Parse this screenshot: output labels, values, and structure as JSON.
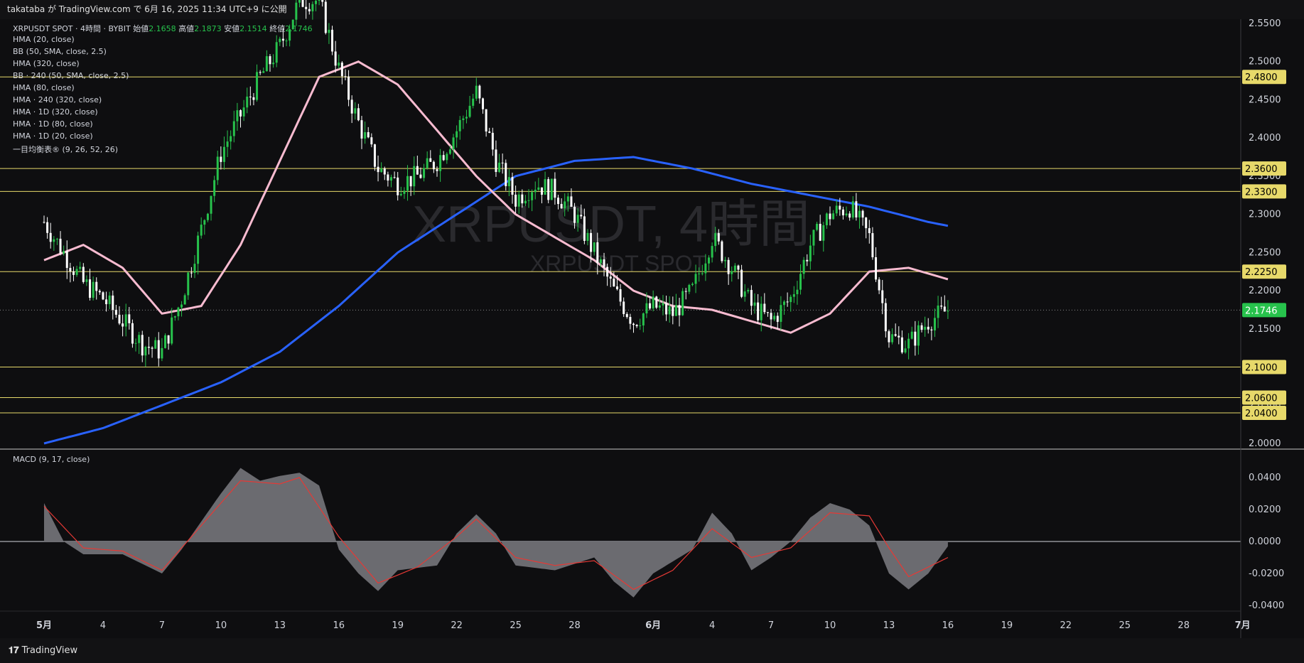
{
  "header": {
    "publish_text": "takataba が TradingView.com で 6月 16, 2025 11:34 UTC+9 に公開"
  },
  "footer": {
    "brand": "TradingView"
  },
  "symbol_info": {
    "name": "XRPUSDT SPOT · 4時間 · BYBIT",
    "open_label": "始値",
    "open": "2.1658",
    "high_label": "高値",
    "high": "2.1873",
    "low_label": "安値",
    "low": "2.1514",
    "close_label": "終値",
    "close": "2.1746"
  },
  "indicators": [
    "HMA (20, close)",
    "BB (50, SMA, close, 2.5)",
    "HMA (320, close)",
    "BB · 240 (50, SMA, close, 2.5)",
    "HMA (80, close)",
    "HMA · 240 (320, close)",
    "HMA · 1D (320, close)",
    "HMA · 1D (80, close)",
    "HMA · 1D (20, close)",
    "一目均衡表® (9, 26, 52, 26)"
  ],
  "watermark": {
    "main": "XRPUSDT, 4時間",
    "sub": "XRPUSDT SPOT"
  },
  "macd_label": "MACD (9, 17, close)",
  "colors": {
    "background": "#0e0e10",
    "up": "#27c24c",
    "down": "#ffffff",
    "level": "#e7d96a",
    "current_price": "#27c24c",
    "hma320": "#2962ff",
    "hma80": "#f8bbd0"
  },
  "chart_data": [
    {
      "type": "candlestick",
      "title": "XRPUSDT SPOT · 4時間 · BYBIT",
      "ylim": [
        2.0,
        2.55
      ],
      "y_ticks": [
        "2.5500",
        "2.5000",
        "2.4500",
        "2.4000",
        "2.3500",
        "2.3000",
        "2.2500",
        "2.2000",
        "2.1500",
        "2.1000",
        "2.0500",
        "2.0000"
      ],
      "x_ticks": [
        {
          "label": "5月",
          "day": 1
        },
        {
          "label": "4",
          "day": 4
        },
        {
          "label": "7",
          "day": 7
        },
        {
          "label": "10",
          "day": 10
        },
        {
          "label": "13",
          "day": 13
        },
        {
          "label": "16",
          "day": 16
        },
        {
          "label": "19",
          "day": 19
        },
        {
          "label": "22",
          "day": 22
        },
        {
          "label": "25",
          "day": 25
        },
        {
          "label": "28",
          "day": 28
        },
        {
          "label": "6月",
          "day": 32
        },
        {
          "label": "4",
          "day": 35
        },
        {
          "label": "7",
          "day": 38
        },
        {
          "label": "10",
          "day": 41
        },
        {
          "label": "13",
          "day": 44
        },
        {
          "label": "16",
          "day": 47
        },
        {
          "label": "19",
          "day": 50
        },
        {
          "label": "22",
          "day": 53
        },
        {
          "label": "25",
          "day": 56
        },
        {
          "label": "28",
          "day": 59
        },
        {
          "label": "7月",
          "day": 62
        }
      ],
      "price_levels": [
        {
          "label": "2.4800",
          "value": 2.48
        },
        {
          "label": "2.3600",
          "value": 2.36
        },
        {
          "label": "2.3300",
          "value": 2.33
        },
        {
          "label": "2.2250",
          "value": 2.225
        },
        {
          "label": "2.1000",
          "value": 2.1
        },
        {
          "label": "2.0600",
          "value": 2.06
        },
        {
          "label": "2.0400",
          "value": 2.04
        }
      ],
      "current_price": {
        "label": "2.1746",
        "value": 2.1746
      },
      "price_path": [
        [
          1,
          2.29
        ],
        [
          2,
          2.25
        ],
        [
          3,
          2.21
        ],
        [
          4,
          2.19
        ],
        [
          5,
          2.16
        ],
        [
          6,
          2.13
        ],
        [
          7,
          2.12
        ],
        [
          8,
          2.19
        ],
        [
          9,
          2.28
        ],
        [
          10,
          2.38
        ],
        [
          11,
          2.43
        ],
        [
          12,
          2.48
        ],
        [
          13,
          2.52
        ],
        [
          14,
          2.58
        ],
        [
          15,
          2.58
        ],
        [
          16,
          2.49
        ],
        [
          17,
          2.42
        ],
        [
          18,
          2.36
        ],
        [
          19,
          2.34
        ],
        [
          20,
          2.35
        ],
        [
          21,
          2.37
        ],
        [
          22,
          2.41
        ],
        [
          23,
          2.46
        ],
        [
          24,
          2.37
        ],
        [
          25,
          2.32
        ],
        [
          26,
          2.34
        ],
        [
          27,
          2.33
        ],
        [
          28,
          2.3
        ],
        [
          29,
          2.25
        ],
        [
          30,
          2.2
        ],
        [
          31,
          2.16
        ],
        [
          32,
          2.18
        ],
        [
          33,
          2.17
        ],
        [
          34,
          2.2
        ],
        [
          35,
          2.27
        ],
        [
          36,
          2.23
        ],
        [
          37,
          2.18
        ],
        [
          38,
          2.16
        ],
        [
          39,
          2.19
        ],
        [
          40,
          2.26
        ],
        [
          41,
          2.3
        ],
        [
          42,
          2.31
        ],
        [
          43,
          2.27
        ],
        [
          44,
          2.14
        ],
        [
          45,
          2.13
        ],
        [
          46,
          2.16
        ],
        [
          47,
          2.175
        ]
      ],
      "series": [
        {
          "name": "HMA (320, close)",
          "color": "#2962ff",
          "points": [
            [
              1,
              2.0
            ],
            [
              4,
              2.02
            ],
            [
              7,
              2.05
            ],
            [
              10,
              2.08
            ],
            [
              13,
              2.12
            ],
            [
              16,
              2.18
            ],
            [
              19,
              2.25
            ],
            [
              22,
              2.3
            ],
            [
              25,
              2.35
            ],
            [
              28,
              2.37
            ],
            [
              31,
              2.375
            ],
            [
              34,
              2.36
            ],
            [
              37,
              2.34
            ],
            [
              40,
              2.325
            ],
            [
              43,
              2.31
            ],
            [
              46,
              2.29
            ],
            [
              47,
              2.285
            ]
          ]
        },
        {
          "name": "HMA (80, close)",
          "color": "#f8bbd0",
          "points": [
            [
              1,
              2.24
            ],
            [
              3,
              2.26
            ],
            [
              5,
              2.23
            ],
            [
              7,
              2.17
            ],
            [
              9,
              2.18
            ],
            [
              11,
              2.26
            ],
            [
              13,
              2.37
            ],
            [
              15,
              2.48
            ],
            [
              17,
              2.5
            ],
            [
              19,
              2.47
            ],
            [
              21,
              2.41
            ],
            [
              23,
              2.35
            ],
            [
              25,
              2.3
            ],
            [
              27,
              2.27
            ],
            [
              29,
              2.24
            ],
            [
              31,
              2.2
            ],
            [
              33,
              2.18
            ],
            [
              35,
              2.175
            ],
            [
              37,
              2.16
            ],
            [
              39,
              2.145
            ],
            [
              41,
              2.17
            ],
            [
              43,
              2.225
            ],
            [
              45,
              2.23
            ],
            [
              47,
              2.215
            ]
          ]
        }
      ]
    },
    {
      "type": "area",
      "title": "MACD (9, 17, close)",
      "ylim": [
        -0.045,
        0.05
      ],
      "y_ticks": [
        "0.0400",
        "0.0200",
        "0.0000",
        "-0.0200",
        "-0.0400"
      ],
      "series": [
        {
          "name": "MACD",
          "points": [
            [
              1,
              0.024
            ],
            [
              2,
              0.0
            ],
            [
              3,
              -0.008
            ],
            [
              5,
              -0.008
            ],
            [
              7,
              -0.02
            ],
            [
              8,
              -0.005
            ],
            [
              10,
              0.03
            ],
            [
              11,
              0.046
            ],
            [
              12,
              0.038
            ],
            [
              13,
              0.041
            ],
            [
              14,
              0.043
            ],
            [
              15,
              0.035
            ],
            [
              16,
              -0.005
            ],
            [
              17,
              -0.02
            ],
            [
              18,
              -0.031
            ],
            [
              19,
              -0.018
            ],
            [
              21,
              -0.015
            ],
            [
              22,
              0.005
            ],
            [
              23,
              0.017
            ],
            [
              24,
              0.005
            ],
            [
              25,
              -0.015
            ],
            [
              27,
              -0.018
            ],
            [
              29,
              -0.01
            ],
            [
              30,
              -0.025
            ],
            [
              31,
              -0.035
            ],
            [
              32,
              -0.02
            ],
            [
              34,
              -0.005
            ],
            [
              35,
              0.018
            ],
            [
              36,
              0.005
            ],
            [
              37,
              -0.018
            ],
            [
              38,
              -0.01
            ],
            [
              39,
              0.0
            ],
            [
              40,
              0.015
            ],
            [
              41,
              0.024
            ],
            [
              42,
              0.02
            ],
            [
              43,
              0.01
            ],
            [
              44,
              -0.02
            ],
            [
              45,
              -0.03
            ],
            [
              46,
              -0.02
            ],
            [
              47,
              -0.003
            ]
          ]
        },
        {
          "name": "Signal",
          "color": "#e53935",
          "points": [
            [
              1,
              0.022
            ],
            [
              3,
              -0.004
            ],
            [
              5,
              -0.006
            ],
            [
              7,
              -0.018
            ],
            [
              9,
              0.01
            ],
            [
              11,
              0.038
            ],
            [
              13,
              0.036
            ],
            [
              14,
              0.04
            ],
            [
              16,
              0.003
            ],
            [
              18,
              -0.026
            ],
            [
              20,
              -0.016
            ],
            [
              22,
              0.003
            ],
            [
              23,
              0.014
            ],
            [
              25,
              -0.01
            ],
            [
              27,
              -0.015
            ],
            [
              29,
              -0.012
            ],
            [
              31,
              -0.03
            ],
            [
              33,
              -0.018
            ],
            [
              35,
              0.008
            ],
            [
              37,
              -0.01
            ],
            [
              39,
              -0.004
            ],
            [
              41,
              0.018
            ],
            [
              43,
              0.016
            ],
            [
              44,
              -0.004
            ],
            [
              45,
              -0.022
            ],
            [
              47,
              -0.01
            ]
          ]
        }
      ]
    }
  ]
}
